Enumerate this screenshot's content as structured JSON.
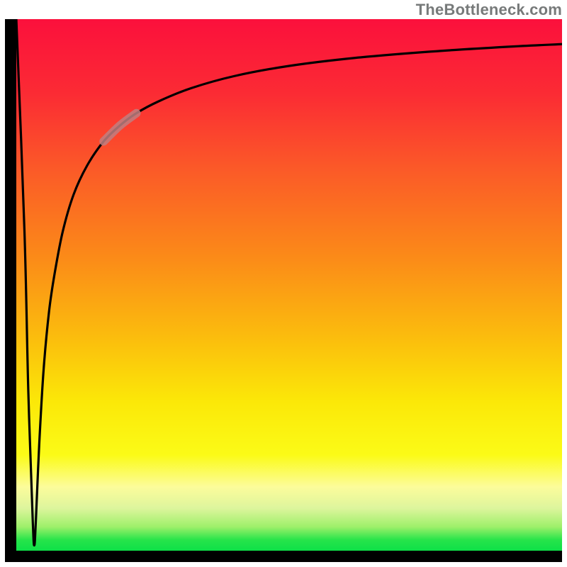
{
  "watermark": "TheBottleneck.com",
  "colors": {
    "frame": "#000000",
    "curve": "#000000",
    "highlight": "#c07f80",
    "gradient_stops": [
      {
        "pct": 0,
        "color": "#fb103c"
      },
      {
        "pct": 14,
        "color": "#fb2b34"
      },
      {
        "pct": 28,
        "color": "#fb5928"
      },
      {
        "pct": 45,
        "color": "#fb8b18"
      },
      {
        "pct": 60,
        "color": "#fbbd0d"
      },
      {
        "pct": 72,
        "color": "#fbe808"
      },
      {
        "pct": 82,
        "color": "#fbfb17"
      },
      {
        "pct": 88,
        "color": "#fcfc9b"
      },
      {
        "pct": 92,
        "color": "#ddf59d"
      },
      {
        "pct": 95.5,
        "color": "#9ef06a"
      },
      {
        "pct": 98,
        "color": "#26e44a"
      },
      {
        "pct": 100,
        "color": "#0ee048"
      }
    ]
  },
  "chart_data": {
    "type": "line",
    "title": "",
    "xlabel": "",
    "ylabel": "",
    "xlim": [
      0,
      100
    ],
    "ylim": [
      0,
      100
    ],
    "grid": false,
    "legend": false,
    "series": [
      {
        "name": "bottleneck-curve",
        "x": [
          0.0,
          1.5,
          2.2,
          3.0,
          3.3,
          3.6,
          4.2,
          5.0,
          6.0,
          7.0,
          8.5,
          10.5,
          13.0,
          16.0,
          19.0,
          22.0,
          26.0,
          32.0,
          40.0,
          50.0,
          62.0,
          76.0,
          90.0,
          100.0
        ],
        "y": [
          100.0,
          60.0,
          30.0,
          6.0,
          1.0,
          6.0,
          20.0,
          34.0,
          45.0,
          52.0,
          60.0,
          67.0,
          72.5,
          77.0,
          80.0,
          82.3,
          84.5,
          87.0,
          89.3,
          91.2,
          92.7,
          93.9,
          94.8,
          95.3
        ]
      }
    ],
    "highlight_segment": {
      "series": "bottleneck-curve",
      "x_start": 16.0,
      "x_end": 22.0
    },
    "background": "vertical-gradient-red-to-green"
  }
}
